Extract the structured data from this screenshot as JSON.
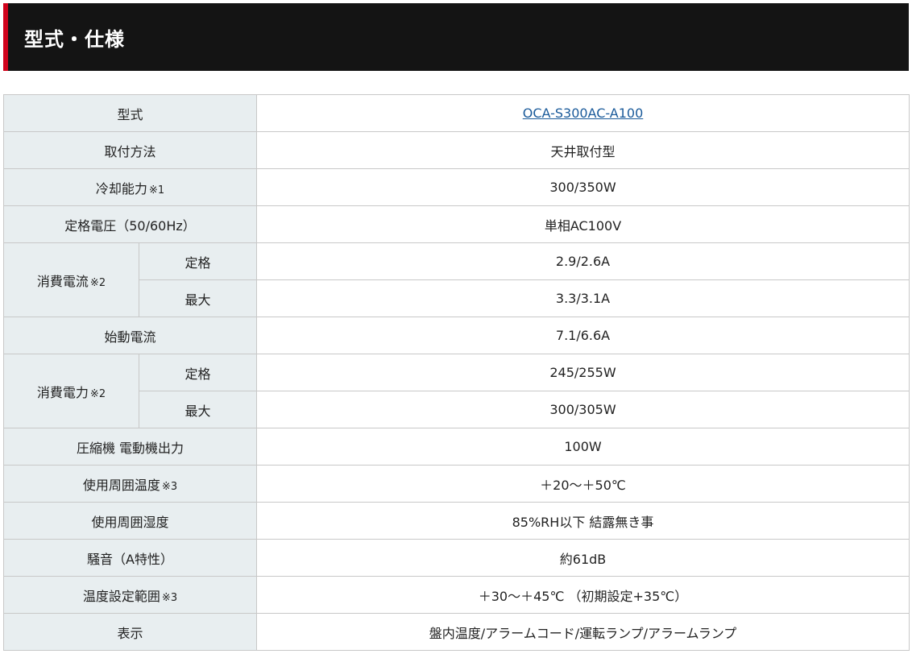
{
  "header": {
    "title": "型式・仕様",
    "accent_color": "#d0021b",
    "background_color": "#141414"
  },
  "spec": {
    "model": {
      "label": "型式",
      "value": "OCA-S300AC-A100"
    },
    "mount": {
      "label": "取付方法",
      "value": "天井取付型"
    },
    "cooling": {
      "label": "冷却能力",
      "note": "※1",
      "value": "300/350W"
    },
    "voltage": {
      "label": "定格電圧（50/60Hz）",
      "value": "単相AC100V"
    },
    "current": {
      "label": "消費電流",
      "note": "※2",
      "rated_label": "定格",
      "rated_value": "2.9/2.6A",
      "max_label": "最大",
      "max_value": "3.3/3.1A"
    },
    "start_current": {
      "label": "始動電流",
      "value": "7.1/6.6A"
    },
    "power": {
      "label": "消費電力",
      "note": "※2",
      "rated_label": "定格",
      "rated_value": "245/255W",
      "max_label": "最大",
      "max_value": "300/305W"
    },
    "compressor": {
      "label": "圧縮機 電動機出力",
      "value": "100W"
    },
    "ambient_temp": {
      "label": "使用周囲温度",
      "note": "※3",
      "value": "＋20～＋50℃"
    },
    "ambient_humidity": {
      "label": "使用周囲湿度",
      "value": "85%RH以下 結露無き事"
    },
    "noise": {
      "label": "騒音（A特性）",
      "value": "約61dB"
    },
    "temp_setting": {
      "label": "温度設定範囲",
      "note": "※3",
      "value": "＋30～＋45℃ （初期設定+35℃）"
    },
    "display": {
      "label": "表示",
      "value": "盤内温度/アラームコード/運転ランプ/アラームランプ"
    }
  }
}
